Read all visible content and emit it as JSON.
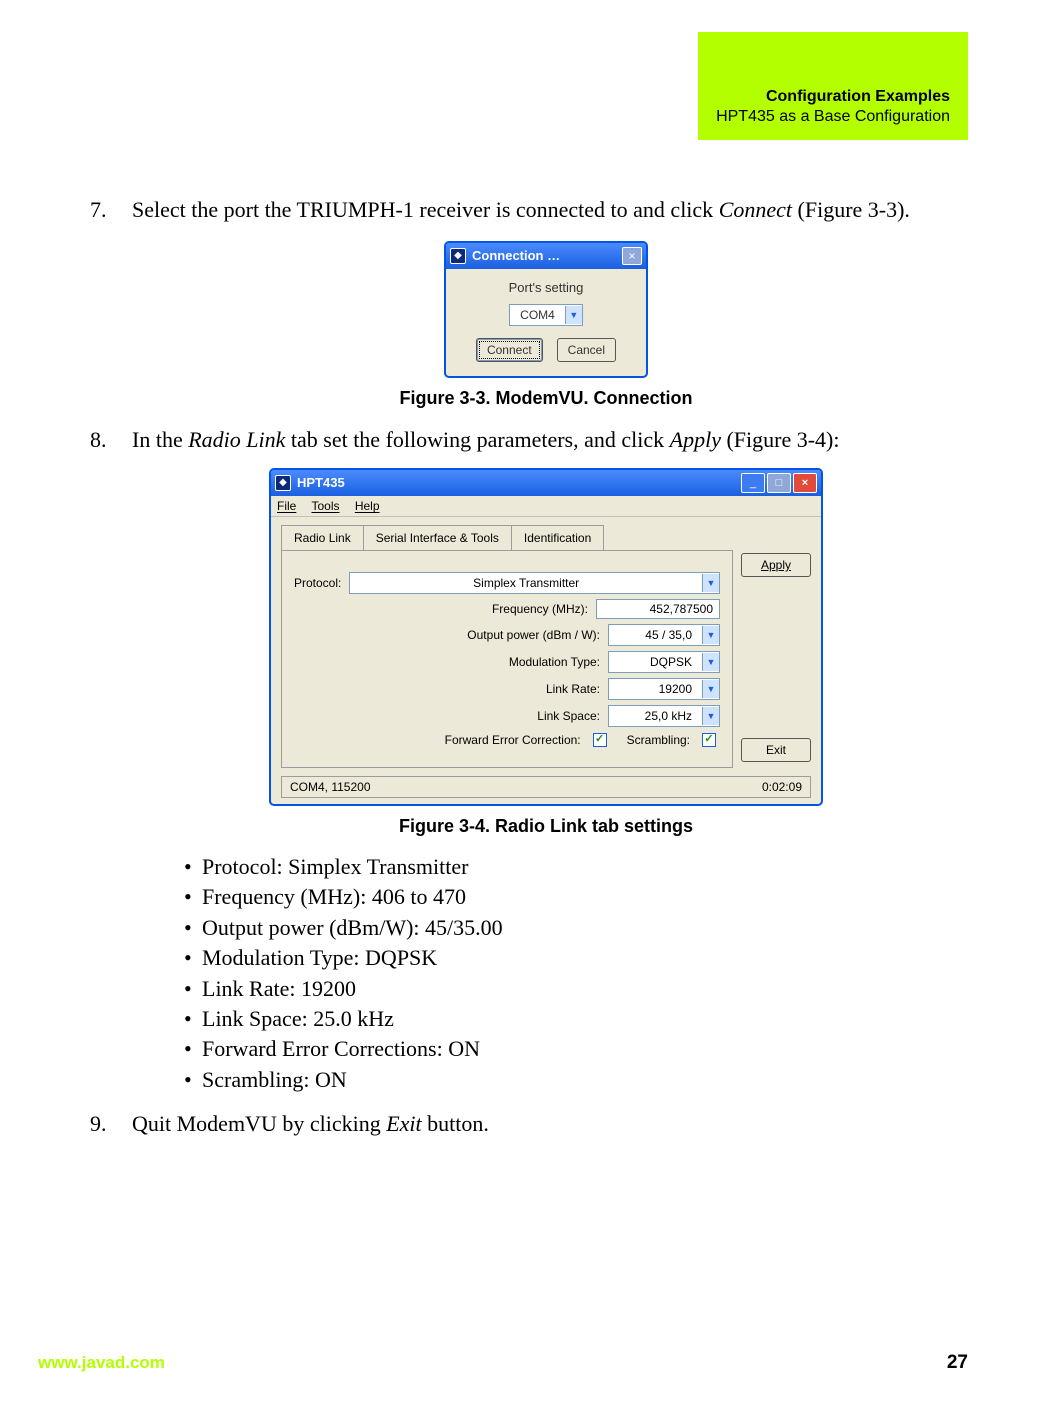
{
  "header": {
    "title": "Configuration Examples",
    "subtitle": "HPT435 as a Base Configuration"
  },
  "steps": {
    "seven": {
      "num": "7.",
      "pre": "Select the port the TRIUMPH-1 receiver is connected to and click ",
      "em": "Connect",
      "post": " (Figure 3-3)."
    },
    "eight": {
      "num": "8.",
      "pre": "In the ",
      "em": "Radio Link",
      "mid": " tab set the following parameters, and click ",
      "em2": "Apply",
      "post": " (Figure 3-4):"
    },
    "nine": {
      "num": "9.",
      "pre": "Quit ModemVU by clicking ",
      "em": "Exit",
      "post": " button."
    }
  },
  "fig33": {
    "caption": "Figure 3-3. ModemVU. Connection",
    "title": "Connection …",
    "ports_label": "Port's setting",
    "port_value": "COM4",
    "connect": "Connect",
    "cancel": "Cancel"
  },
  "fig34": {
    "caption": "Figure 3-4. Radio Link tab settings",
    "title": "HPT435",
    "menu": {
      "file": "File",
      "tools": "Tools",
      "help": "Help"
    },
    "tabs": {
      "radio": "Radio Link",
      "serial": "Serial Interface & Tools",
      "ident": "Identification"
    },
    "apply": "Apply",
    "exit": "Exit",
    "labels": {
      "protocol": "Protocol:",
      "freq": "Frequency (MHz):",
      "power": "Output power (dBm / W):",
      "mod": "Modulation Type:",
      "rate": "Link Rate:",
      "space": "Link Space:",
      "fec": "Forward Error Correction:",
      "scr": "Scrambling:"
    },
    "vals": {
      "protocol": "Simplex Transmitter",
      "freq": "452,787500",
      "power": "45 / 35,0",
      "mod": "DQPSK",
      "rate": "19200",
      "space": "25,0 kHz"
    },
    "status": {
      "left": "COM4, 115200",
      "right": "0:02:09"
    }
  },
  "bullets": [
    "Protocol: Simplex Transmitter",
    "Frequency (MHz): 406 to 470",
    "Output power (dBm/W): 45/35.00",
    "Modulation Type: DQPSK",
    "Link Rate: 19200",
    "Link Space: 25.0 kHz",
    "Forward Error Corrections: ON",
    "Scrambling: ON"
  ],
  "footer": {
    "url": "www.javad.com",
    "page": "27"
  }
}
